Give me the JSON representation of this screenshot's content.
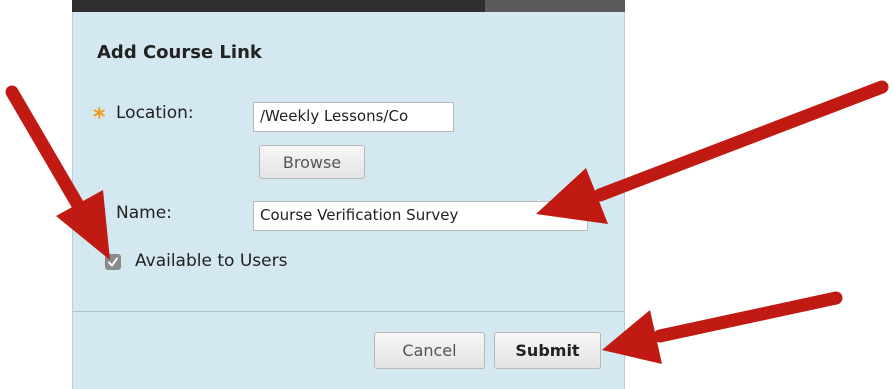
{
  "dialog": {
    "title": "Add Course Link",
    "location": {
      "label": "Location:",
      "value": "/Weekly Lessons/Co",
      "browse_label": "Browse"
    },
    "name": {
      "label": "Name:",
      "value": "Course Verification Survey"
    },
    "available": {
      "label": "Available to Users",
      "checked": true
    },
    "cancel_label": "Cancel",
    "submit_label": "Submit"
  },
  "colors": {
    "dialog_background": "#d3e8f0",
    "required_asterisk": "#f29a1a",
    "annotation_arrow": "#c01a12"
  },
  "icons": {
    "required": "asterisk-icon",
    "checkbox": "checkmark-icon",
    "annotation": "red-arrow-icon"
  }
}
